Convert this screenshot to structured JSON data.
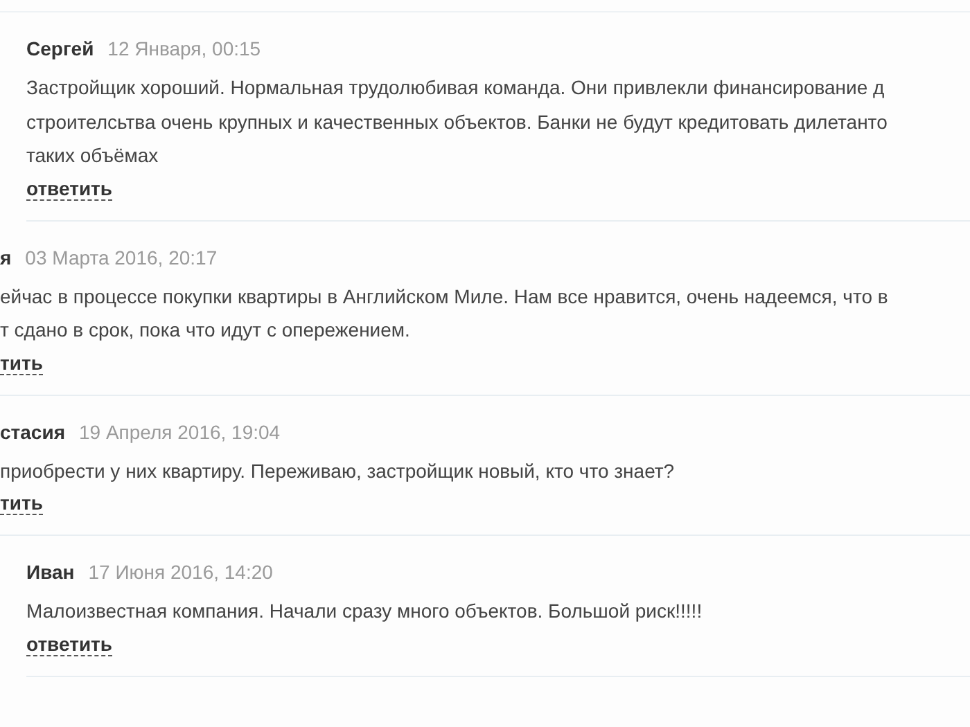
{
  "comments": [
    {
      "kind": "reply",
      "author": "Сергей",
      "date": "12 Января, 00:15",
      "lines": [
        "Застройщик хороший. Нормальная трудолюбивая команда. Они привлекли финансирование д",
        "строителсьтва очень крупных и качественных объектов. Банки не будут кредитовать дилетанто",
        "таких объёмах"
      ],
      "reply_link": "ответить"
    },
    {
      "kind": "comment",
      "author": "я",
      "date": "03 Марта 2016, 20:17",
      "lines": [
        "ейчас в процессе покупки квартиры в Английском Миле. Нам все нравится, очень надеемся, что в",
        "т сдано в срок, пока что идут с опережением."
      ],
      "reply_link": "тить"
    },
    {
      "kind": "comment",
      "author": "стасия",
      "date": "19 Апреля 2016, 19:04",
      "lines": [
        "приобрести у них квартиру. Переживаю, застройщик новый, кто что знает?"
      ],
      "reply_link": "тить"
    },
    {
      "kind": "reply",
      "author": "Иван",
      "date": "17 Июня 2016, 14:20",
      "lines": [
        "Малоизвестная компания. Начали сразу много объектов. Большой риск!!!!!"
      ],
      "reply_link": "ответить"
    }
  ]
}
